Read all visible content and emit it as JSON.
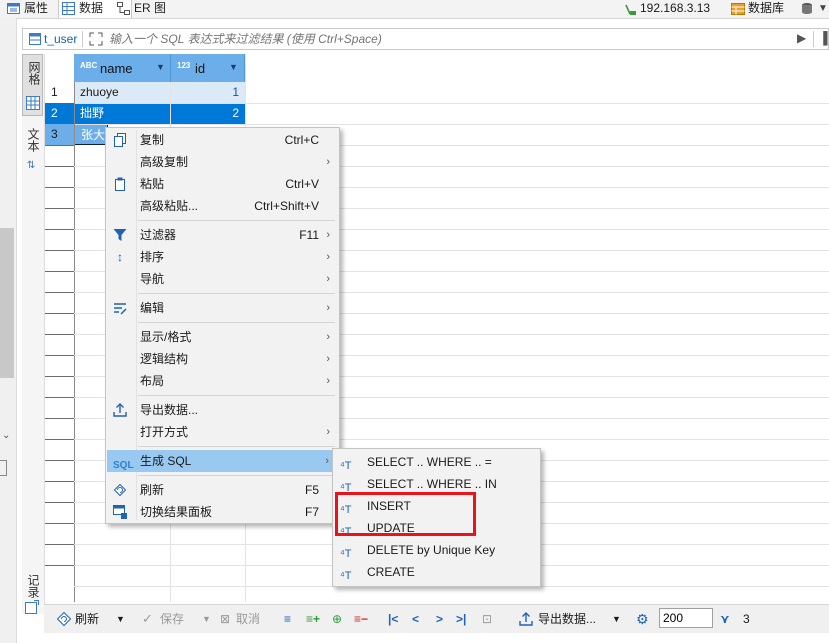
{
  "top_tabs": [
    {
      "label": "属性",
      "icon": "properties-icon"
    },
    {
      "label": "数据",
      "icon": "data-grid-icon"
    },
    {
      "label": "ER 图",
      "icon": "er-diagram-icon"
    }
  ],
  "connection": {
    "host": "192.168.3.13",
    "database_label": "数据库"
  },
  "filter": {
    "table": "t_user",
    "placeholder": "输入一个 SQL 表达式来过滤结果 (使用 Ctrl+Space)"
  },
  "side_tabs": {
    "grid": "网格",
    "text": "文本",
    "record": "记录"
  },
  "grid": {
    "columns": [
      {
        "type_badge": "ABC",
        "name": "name"
      },
      {
        "type_badge": "123",
        "name": "id"
      }
    ],
    "rows": [
      {
        "num": "1",
        "name": "zhuoye",
        "id": "1"
      },
      {
        "num": "2",
        "name": "拙野",
        "id": "2"
      },
      {
        "num": "3",
        "name": "张大",
        "id": ""
      }
    ]
  },
  "context_menu": {
    "items": [
      {
        "label": "复制",
        "shortcut": "Ctrl+C",
        "icon": "copy-icon"
      },
      {
        "label": "高级复制",
        "submenu": true
      },
      {
        "label": "粘贴",
        "shortcut": "Ctrl+V",
        "icon": "paste-icon"
      },
      {
        "label": "高级粘贴...",
        "shortcut": "Ctrl+Shift+V"
      },
      {
        "label": "过滤器",
        "shortcut": "F11",
        "submenu": true,
        "icon": "filter-icon"
      },
      {
        "label": "排序",
        "submenu": true,
        "icon": "sort-icon"
      },
      {
        "label": "导航",
        "submenu": true
      },
      {
        "label": "编辑",
        "submenu": true,
        "icon": "edit-icon"
      },
      {
        "label": "显示/格式",
        "submenu": true
      },
      {
        "label": "逻辑结构",
        "submenu": true
      },
      {
        "label": "布局",
        "submenu": true
      },
      {
        "label": "导出数据...",
        "icon": "export-icon"
      },
      {
        "label": "打开方式",
        "submenu": true
      },
      {
        "label": "生成 SQL",
        "submenu": true,
        "icon": "sql-icon",
        "highlighted": true
      },
      {
        "label": "刷新",
        "shortcut": "F5",
        "icon": "refresh-icon"
      },
      {
        "label": "切换结果面板",
        "shortcut": "F7",
        "icon": "toggle-panel-icon"
      }
    ],
    "sql_icon_text": "SQL"
  },
  "sql_submenu": {
    "items": [
      {
        "label": "SELECT .. WHERE .. ="
      },
      {
        "label": "SELECT .. WHERE .. IN"
      },
      {
        "label": "INSERT",
        "boxed": true
      },
      {
        "label": "UPDATE",
        "boxed": true
      },
      {
        "label": "DELETE by Unique Key"
      },
      {
        "label": "CREATE"
      }
    ],
    "highlight_color": "#e8141b"
  },
  "bottom_toolbar": {
    "refresh": "刷新",
    "save": "保存",
    "cancel": "取消",
    "export": "导出数据...",
    "fetch_size": "200",
    "row_count": "3"
  },
  "colors": {
    "selection": "#0078d7",
    "header": "#6baee9",
    "menu_highlight": "#99c9f1"
  }
}
